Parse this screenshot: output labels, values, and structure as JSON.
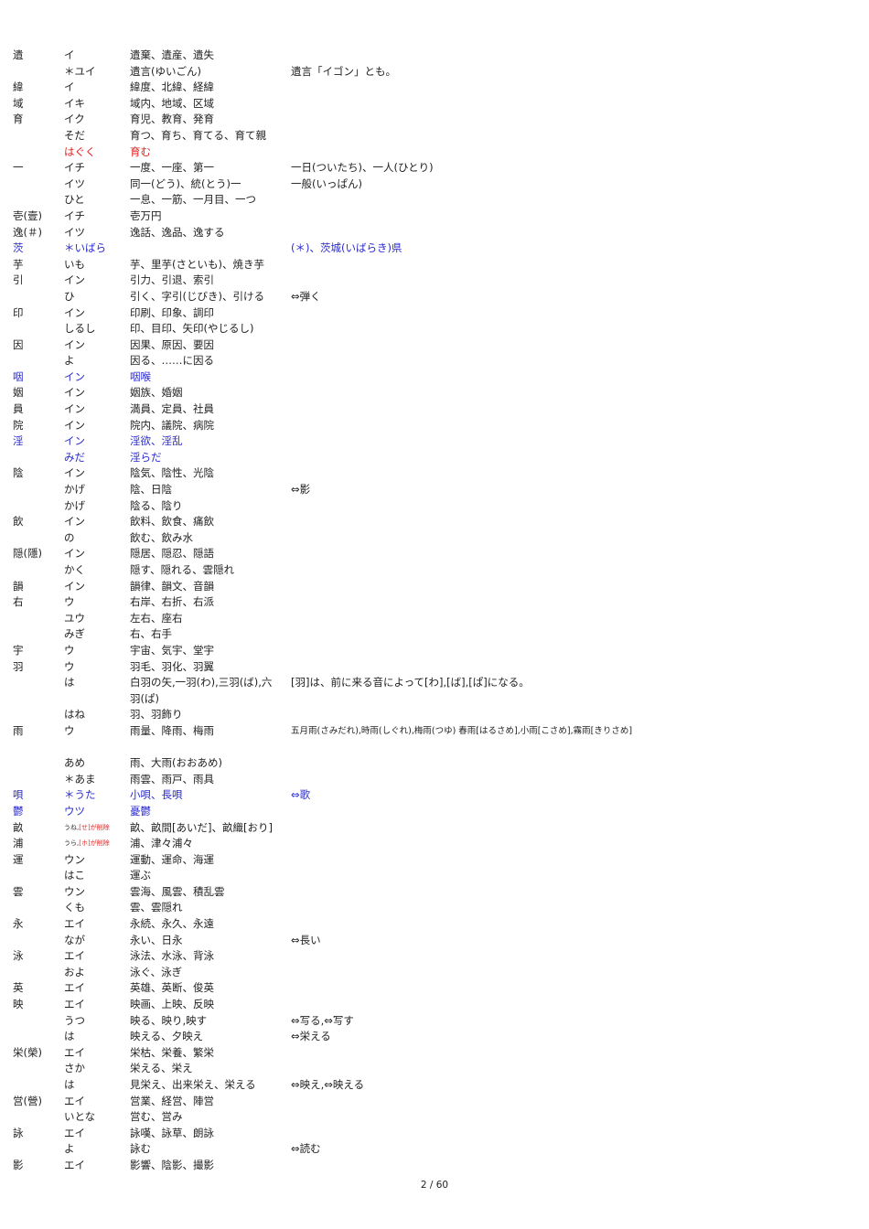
{
  "rows": [
    {
      "kanji": "遺",
      "reading": "イ",
      "examples": "遺棄、遺産、遺失",
      "notes": ""
    },
    {
      "kanji": "",
      "reading": "＊ユイ",
      "examples": "遺言(ゆいごん)",
      "notes": "遺言「イゴン」とも。"
    },
    {
      "kanji": "緯",
      "reading": "イ",
      "examples": "緯度、北緯、経緯",
      "notes": ""
    },
    {
      "kanji": "域",
      "reading": "イキ",
      "examples": "域内、地域、区域",
      "notes": ""
    },
    {
      "kanji": "育",
      "reading": "イク",
      "examples": "育児、教育、発育",
      "notes": ""
    },
    {
      "kanji": "",
      "reading": "そだ",
      "examples": "育つ、育ち、育てる、育て親",
      "notes": ""
    },
    {
      "kanji": "",
      "reading": "はぐく",
      "examples": "育む",
      "notes": "",
      "color": "red"
    },
    {
      "kanji": "一",
      "reading": "イチ",
      "examples": "一度、一座、第一",
      "notes": "一日(ついたち)、一人(ひとり)"
    },
    {
      "kanji": "",
      "reading": "イツ",
      "examples": "同一(どう)、統(とう)一",
      "notes": "一般(いっぱん)"
    },
    {
      "kanji": "",
      "reading": "ひと",
      "examples": "一息、一筋、一月目、一つ",
      "notes": ""
    },
    {
      "kanji": "壱(壹)",
      "reading": "イチ",
      "examples": "壱万円",
      "notes": ""
    },
    {
      "kanji": "逸(＃)",
      "reading": "イツ",
      "examples": "逸話、逸品、逸する",
      "notes": ""
    },
    {
      "kanji": "茨",
      "reading": "＊いばら",
      "examples": "",
      "notes": "(＊)、茨城(いばらき)県",
      "color": "blue"
    },
    {
      "kanji": "芋",
      "reading": "いも",
      "examples": "芋、里芋(さといも)、焼き芋",
      "notes": ""
    },
    {
      "kanji": "引",
      "reading": "イン",
      "examples": "引力、引退、索引",
      "notes": ""
    },
    {
      "kanji": "",
      "reading": "ひ",
      "examples": "引く、字引(じびき)、引ける",
      "notes": "⇔弾く"
    },
    {
      "kanji": "印",
      "reading": "イン",
      "examples": "印刷、印象、調印",
      "notes": ""
    },
    {
      "kanji": "",
      "reading": "しるし",
      "examples": "印、目印、矢印(やじるし)",
      "notes": ""
    },
    {
      "kanji": "因",
      "reading": "イン",
      "examples": "因果、原因、要因",
      "notes": ""
    },
    {
      "kanji": "",
      "reading": "よ",
      "examples": "因る、……に因る",
      "notes": ""
    },
    {
      "kanji": "咽",
      "reading": "イン",
      "examples": "咽喉",
      "notes": "",
      "color": "blue"
    },
    {
      "kanji": "姻",
      "reading": "イン",
      "examples": "姻族、婚姻",
      "notes": ""
    },
    {
      "kanji": "員",
      "reading": "イン",
      "examples": "満員、定員、社員",
      "notes": ""
    },
    {
      "kanji": "院",
      "reading": "イン",
      "examples": "院内、議院、病院",
      "notes": ""
    },
    {
      "kanji": "淫",
      "reading": "イン",
      "examples": "淫欲、淫乱",
      "notes": "",
      "color": "blue"
    },
    {
      "kanji": "",
      "reading": "みだ",
      "examples": "淫らだ",
      "notes": "",
      "color": "blue"
    },
    {
      "kanji": "陰",
      "reading": "イン",
      "examples": "陰気、陰性、光陰",
      "notes": ""
    },
    {
      "kanji": "",
      "reading": "かげ",
      "examples": "陰、日陰",
      "notes": "⇔影"
    },
    {
      "kanji": "",
      "reading": "かげ",
      "examples": "陰る、陰り",
      "notes": ""
    },
    {
      "kanji": "飲",
      "reading": "イン",
      "examples": "飲料、飲食、痛飲",
      "notes": ""
    },
    {
      "kanji": "",
      "reading": "の",
      "examples": "飲む、飲み水",
      "notes": ""
    },
    {
      "kanji": "隠(隱)",
      "reading": "イン",
      "examples": "隠居、隠忍、隠語",
      "notes": ""
    },
    {
      "kanji": "",
      "reading": "かく",
      "examples": "隠す、隠れる、雲隠れ",
      "notes": ""
    },
    {
      "kanji": "韻",
      "reading": "イン",
      "examples": "韻律、韻文、音韻",
      "notes": ""
    },
    {
      "kanji": "右",
      "reading": "ウ",
      "examples": "右岸、右折、右派",
      "notes": ""
    },
    {
      "kanji": "",
      "reading": "ユウ",
      "examples": "左右、座右",
      "notes": ""
    },
    {
      "kanji": "",
      "reading": "みぎ",
      "examples": "右、右手",
      "notes": ""
    },
    {
      "kanji": "宇",
      "reading": "ウ",
      "examples": "宇宙、気宇、堂宇",
      "notes": ""
    },
    {
      "kanji": "羽",
      "reading": "ウ",
      "examples": "羽毛、羽化、羽翼",
      "notes": ""
    },
    {
      "kanji": "",
      "reading": "は",
      "examples": "白羽の矢,一羽(わ),三羽(ば),六羽(ぱ)",
      "notes": "[羽]は、前に来る音によって[わ],[ば],[ぱ]になる。",
      "tall": true
    },
    {
      "kanji": "",
      "reading": "はね",
      "examples": "羽、羽飾り",
      "notes": ""
    },
    {
      "kanji": "雨",
      "reading": "ウ",
      "examples": "雨量、降雨、梅雨",
      "notes": "五月雨(さみだれ),時雨(しぐれ),梅雨(つゆ) 春雨[はるさめ],小雨[こさめ],霧雨[きりさめ]",
      "tall": true,
      "small_notes": true
    },
    {
      "kanji": "",
      "reading": "あめ",
      "examples": "雨、大雨(おおあめ)",
      "notes": ""
    },
    {
      "kanji": "",
      "reading": "＊あま",
      "examples": "雨雲、雨戸、雨具",
      "notes": ""
    },
    {
      "kanji": "唄",
      "reading": "＊うた",
      "examples": "小唄、長唄",
      "notes": "⇔歌",
      "color": "blue"
    },
    {
      "kanji": "鬱",
      "reading": "ウツ",
      "examples": "憂鬱",
      "notes": "",
      "color": "blue"
    },
    {
      "kanji": "畝",
      "reading": "",
      "reading_main": "うね,",
      "reading_red": "[せ]が削除",
      "examples": "畝、畝間[あいだ]、畝織[おり]",
      "notes": "",
      "tiny": true
    },
    {
      "kanji": "浦",
      "reading": "",
      "reading_main": "うら,",
      "reading_red": "[ホ]が削除",
      "examples": "浦、津々浦々",
      "notes": "",
      "tiny": true
    },
    {
      "kanji": "運",
      "reading": "ウン",
      "examples": "運動、運命、海運",
      "notes": ""
    },
    {
      "kanji": "",
      "reading": "はこ",
      "examples": "運ぶ",
      "notes": ""
    },
    {
      "kanji": "雲",
      "reading": "ウン",
      "examples": "雲海、風雲、積乱雲",
      "notes": ""
    },
    {
      "kanji": "",
      "reading": "くも",
      "examples": "雲、雲隠れ",
      "notes": ""
    },
    {
      "kanji": "永",
      "reading": "エイ",
      "examples": "永続、永久、永遠",
      "notes": ""
    },
    {
      "kanji": "",
      "reading": "なが",
      "examples": "永い、日永",
      "notes": "⇔長い"
    },
    {
      "kanji": "泳",
      "reading": "エイ",
      "examples": "泳法、水泳、背泳",
      "notes": ""
    },
    {
      "kanji": "",
      "reading": "およ",
      "examples": "泳ぐ、泳ぎ",
      "notes": ""
    },
    {
      "kanji": "英",
      "reading": "エイ",
      "examples": "英雄、英断、俊英",
      "notes": ""
    },
    {
      "kanji": "映",
      "reading": "エイ",
      "examples": "映画、上映、反映",
      "notes": ""
    },
    {
      "kanji": "",
      "reading": "うつ",
      "examples": "映る、映り,映す",
      "notes": "⇔写る,⇔写す"
    },
    {
      "kanji": "",
      "reading": "は",
      "examples": "映える、夕映え",
      "notes": "⇔栄える"
    },
    {
      "kanji": "栄(榮)",
      "reading": "エイ",
      "examples": "栄枯、栄養、繁栄",
      "notes": ""
    },
    {
      "kanji": "",
      "reading": "さか",
      "examples": "栄える、栄え",
      "notes": ""
    },
    {
      "kanji": "",
      "reading": "は",
      "examples": "見栄え、出来栄え、栄える",
      "notes": "⇔映え,⇔映える"
    },
    {
      "kanji": "営(營)",
      "reading": "エイ",
      "examples": "営業、経営、陣営",
      "notes": ""
    },
    {
      "kanji": "",
      "reading": "いとな",
      "examples": "営む、営み",
      "notes": ""
    },
    {
      "kanji": "詠",
      "reading": "エイ",
      "examples": "詠嘆、詠草、朗詠",
      "notes": ""
    },
    {
      "kanji": "",
      "reading": "よ",
      "examples": "詠む",
      "notes": "⇔読む"
    },
    {
      "kanji": "影",
      "reading": "エイ",
      "examples": "影響、陰影、撮影",
      "notes": ""
    }
  ],
  "footer": {
    "page_number": "2 / 60"
  },
  "colors": {
    "red": "#e02020",
    "blue": "#2a2ad0",
    "text": "#222222"
  }
}
